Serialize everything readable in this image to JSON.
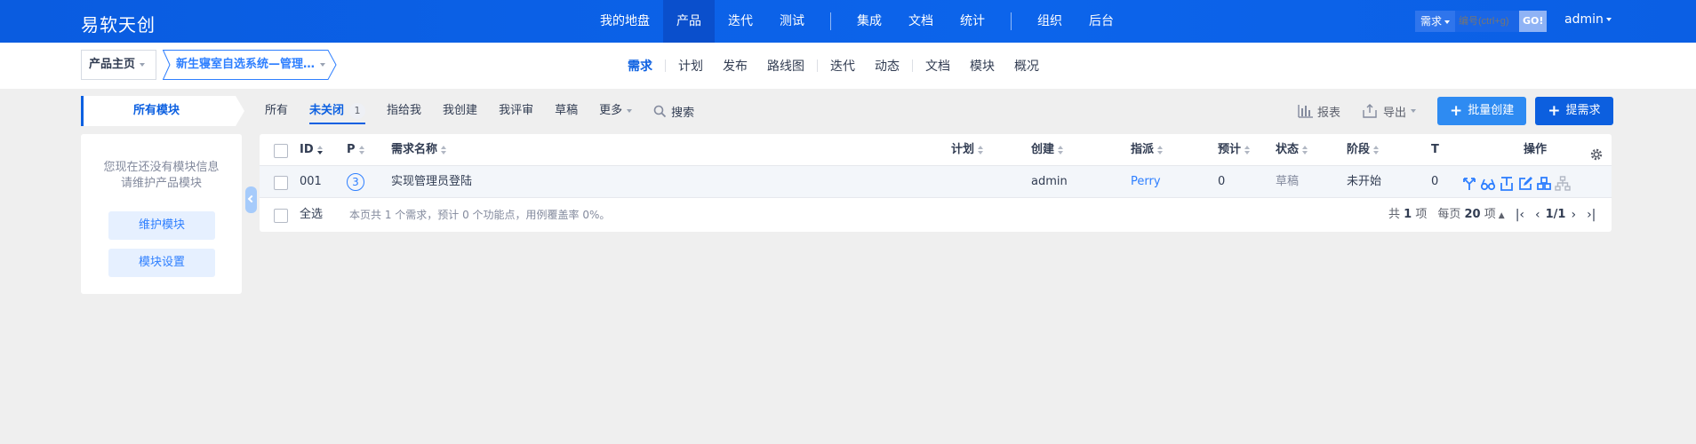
{
  "app": {
    "brand": "易软天创"
  },
  "main_nav": {
    "items": [
      {
        "label": "我的地盘",
        "active": false
      },
      {
        "label": "产品",
        "active": true
      },
      {
        "label": "迭代",
        "active": false
      },
      {
        "label": "测试",
        "active": false
      },
      {
        "label": "集成",
        "active": false
      },
      {
        "label": "文档",
        "active": false
      },
      {
        "label": "统计",
        "active": false
      },
      {
        "label": "组织",
        "active": false
      },
      {
        "label": "后台",
        "active": false
      }
    ]
  },
  "global_search": {
    "type": "需求",
    "placeholder": "编号(ctrl+g)",
    "go": "GO!"
  },
  "user": {
    "name": "admin"
  },
  "breadcrumb": {
    "home": "产品主页",
    "product": "新生寝室自选系统—管理…"
  },
  "sub_nav": {
    "items": [
      {
        "label": "需求",
        "active": true
      },
      {
        "label": "计划"
      },
      {
        "label": "发布"
      },
      {
        "label": "路线图"
      },
      {
        "label": "迭代"
      },
      {
        "label": "动态"
      },
      {
        "label": "文档"
      },
      {
        "label": "模块"
      },
      {
        "label": "概况"
      }
    ]
  },
  "sidebar": {
    "module_tab": "所有模块",
    "empty_line1": "您现在还没有模块信息",
    "empty_line2": "请维护产品模块",
    "maintain_button": "维护模块",
    "settings_button": "模块设置"
  },
  "filters": {
    "items": [
      {
        "label": "所有",
        "active": false
      },
      {
        "label": "未关闭",
        "active": true,
        "count": "1"
      },
      {
        "label": "指给我",
        "active": false
      },
      {
        "label": "我创建",
        "active": false
      },
      {
        "label": "我评审",
        "active": false
      },
      {
        "label": "草稿",
        "active": false
      },
      {
        "label": "更多",
        "active": false
      }
    ],
    "search": "搜索"
  },
  "toolbar": {
    "report": "报表",
    "export": "导出",
    "batch_create": "批量创建",
    "create": "提需求"
  },
  "table": {
    "columns": {
      "id": "ID",
      "pri": "P",
      "title": "需求名称",
      "plan": "计划",
      "opened_by": "创建",
      "assigned_to": "指派",
      "estimate": "预计",
      "status": "状态",
      "stage": "阶段",
      "task": "T",
      "actions": "操作"
    },
    "rows": [
      {
        "id": "001",
        "pri": "3",
        "title": "实现管理员登陆",
        "plan": "",
        "opened_by": "admin",
        "assigned_to": "Perry",
        "estimate": "0",
        "status": "草稿",
        "stage": "未开始",
        "task": "0"
      }
    ],
    "footer": {
      "select_all": "全选",
      "summary": "本页共 1 个需求，预计 0 个功能点，用例覆盖率 0%。",
      "total_prefix": "共",
      "total": "1",
      "total_suffix": "项",
      "per_page_prefix": "每页",
      "per_page": "20",
      "per_page_suffix": "项",
      "page": "1/1"
    }
  },
  "colors": {
    "primary": "#0c60e1",
    "header": "#0c64eb",
    "accent": "#2e8bf2"
  }
}
